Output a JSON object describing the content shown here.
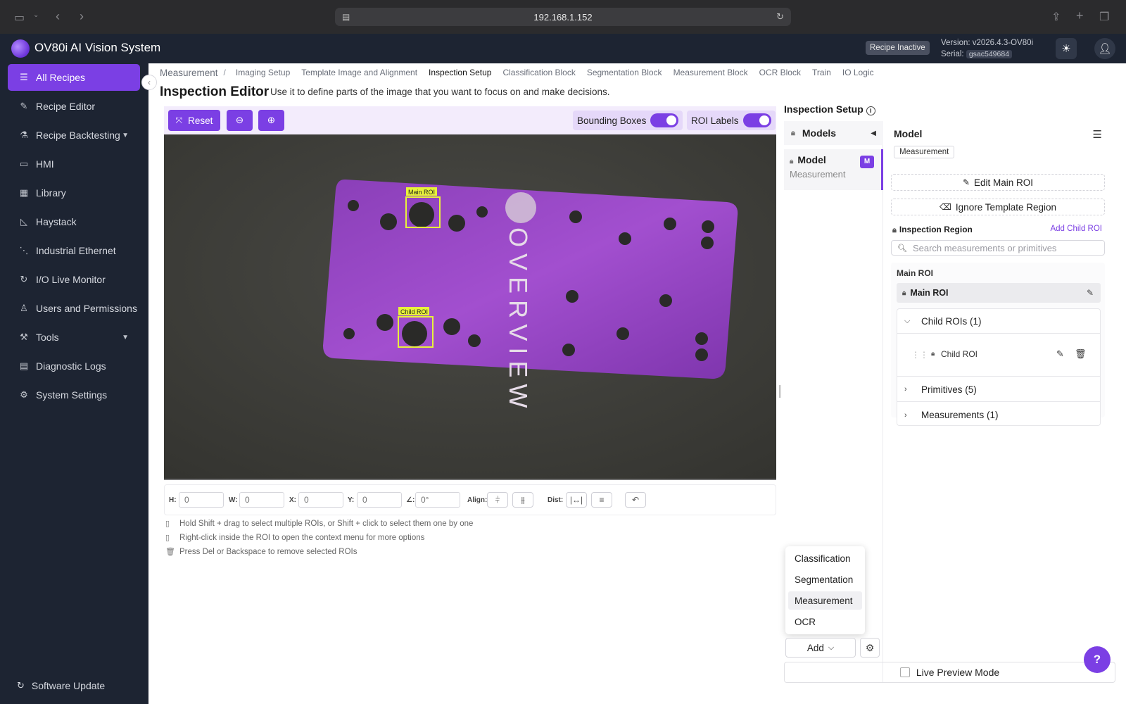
{
  "browser": {
    "url": "192.168.1.152"
  },
  "header": {
    "app_title": "OV80i AI Vision System",
    "recipe_status": "Recipe Inactive",
    "version_label": "Version: v2026.4.3-OV80i",
    "serial_label": "Serial:",
    "serial_value": "gsac549684"
  },
  "sidebar": {
    "items": [
      {
        "label": "All Recipes",
        "icon": "list-icon",
        "active": true
      },
      {
        "label": "Recipe Editor",
        "icon": "pen-icon"
      },
      {
        "label": "Recipe Backtesting",
        "icon": "flask-icon",
        "expandable": true
      },
      {
        "label": "HMI",
        "icon": "monitor-icon"
      },
      {
        "label": "Library",
        "icon": "grid-icon"
      },
      {
        "label": "Haystack",
        "icon": "chart-icon"
      },
      {
        "label": "Industrial Ethernet",
        "icon": "network-icon"
      },
      {
        "label": "I/O Live Monitor",
        "icon": "refresh-icon"
      },
      {
        "label": "Users and Permissions",
        "icon": "user-icon"
      },
      {
        "label": "Tools",
        "icon": "wrench-icon",
        "expandable": true
      },
      {
        "label": "Diagnostic Logs",
        "icon": "log-icon"
      },
      {
        "label": "System Settings",
        "icon": "gear-icon"
      }
    ],
    "footer_label": "Software Update"
  },
  "breadcrumb": {
    "root": "Measurement",
    "separator": "/",
    "tabs": [
      "Imaging Setup",
      "Template Image and Alignment",
      "Inspection Setup",
      "Classification Block",
      "Segmentation Block",
      "Measurement Block",
      "OCR Block",
      "Train",
      "IO Logic"
    ],
    "active_tab": "Inspection Setup"
  },
  "page": {
    "title": "Inspection Editor",
    "description": "Use it to define parts of the image that you want to focus on and make decisions."
  },
  "editor_toolbar": {
    "reset_label": "Reset",
    "bounding_boxes_label": "Bounding Boxes",
    "bounding_boxes_on": true,
    "roi_labels_label": "ROI Labels",
    "roi_labels_on": true
  },
  "canvas": {
    "main_roi_label": "Main ROI",
    "child_roi_label": "Child ROI",
    "part_text": "OVERVIEW"
  },
  "props": {
    "h_label": "H:",
    "h_placeholder": "0",
    "w_label": "W:",
    "w_placeholder": "0",
    "x_label": "X:",
    "x_placeholder": "0",
    "y_label": "Y:",
    "y_placeholder": "0",
    "angle_label": "∠:",
    "angle_placeholder": "0°",
    "align_label": "Align:",
    "dist_label": "Dist:"
  },
  "hints": [
    "Hold Shift + drag to select multiple ROIs, or Shift + click to select them one by one",
    "Right-click inside the ROI to open the context menu for more options",
    "Press Del or Backspace to remove selected ROIs"
  ],
  "right_panel": {
    "title": "Inspection Setup",
    "models_header": "Models",
    "model_item": {
      "name": "Model",
      "type": "Measurement",
      "badge": "M"
    },
    "detail": {
      "title": "Model",
      "tag": "Measurement",
      "edit_main_roi": "Edit Main ROI",
      "ignore_template_region": "Ignore Template Region",
      "inspection_region": "Inspection Region",
      "add_child_roi": "Add Child ROI",
      "search_placeholder": "Search measurements or primitives",
      "main_roi_section": "Main ROI",
      "main_roi_row": "Main ROI",
      "child_rois": "Child ROIs (1)",
      "child_roi_item": "Child ROI",
      "primitives": "Primitives (5)",
      "measurements": "Measurements (1)"
    },
    "add_menu": {
      "options": [
        "Classification",
        "Segmentation",
        "Measurement",
        "OCR"
      ],
      "highlighted": "Measurement"
    },
    "add_label": "Add",
    "live_preview_label": "Live Preview Mode",
    "live_preview_checked": false
  },
  "colors": {
    "accent": "#7b3fe4",
    "sidebar_bg": "#1d2432",
    "roi_box": "#e8f23a"
  }
}
